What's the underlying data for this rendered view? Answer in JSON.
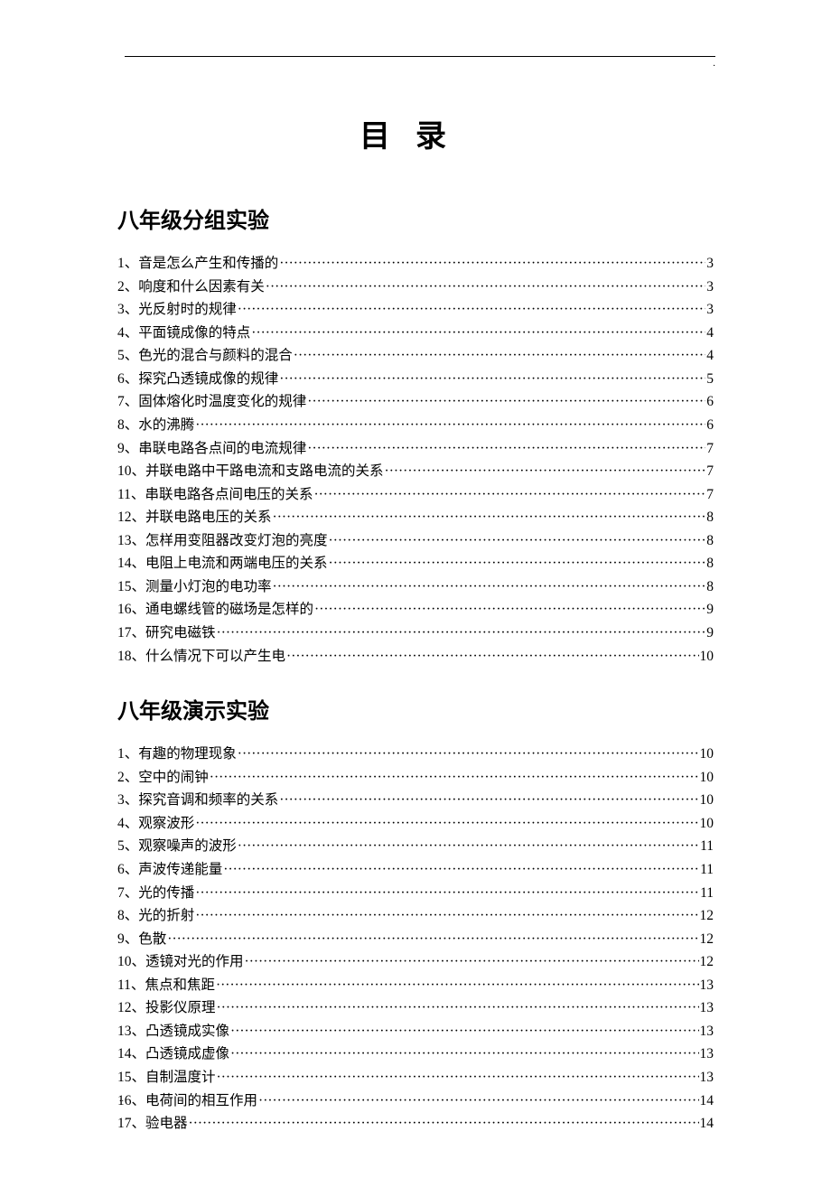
{
  "title": "目录",
  "sections": [
    {
      "header": "八年级分组实验",
      "items": [
        {
          "num": "1、",
          "label": "音是怎么产生和传播的",
          "page": "3"
        },
        {
          "num": "2、",
          "label": "响度和什么因素有关",
          "page": "3"
        },
        {
          "num": "3、",
          "label": "光反射时的规律",
          "page": "3"
        },
        {
          "num": "4、",
          "label": "平面镜成像的特点",
          "page": "4"
        },
        {
          "num": "5、",
          "label": "色光的混合与颜料的混合",
          "page": "4"
        },
        {
          "num": "6、",
          "label": "探究凸透镜成像的规律",
          "page": "5"
        },
        {
          "num": "7、",
          "label": "固体熔化时温度变化的规律",
          "page": "6"
        },
        {
          "num": "8、",
          "label": "水的沸腾",
          "page": "6"
        },
        {
          "num": "9、",
          "label": "串联电路各点间的电流规律",
          "page": "7"
        },
        {
          "num": "10、",
          "label": "并联电路中干路电流和支路电流的关系 ",
          "page": "7"
        },
        {
          "num": "11、",
          "label": "串联电路各点间电压的关系 ",
          "page": "7"
        },
        {
          "num": "12、",
          "label": "并联电路电压的关系 ",
          "page": "8"
        },
        {
          "num": "13、",
          "label": "怎样用变阻器改变灯泡的亮度 ",
          "page": "8"
        },
        {
          "num": "14、",
          "label": "电阻上电流和两端电压的关系 ",
          "page": "8"
        },
        {
          "num": "15、",
          "label": "测量小灯泡的电功率 ",
          "page": "8"
        },
        {
          "num": "16、",
          "label": "通电螺线管的磁场是怎样的 ",
          "page": "9"
        },
        {
          "num": "17、",
          "label": "研究电磁铁 ",
          "page": "9"
        },
        {
          "num": "18、",
          "label": "什么情况下可以产生电 ",
          "page": "10"
        }
      ]
    },
    {
      "header": "八年级演示实验",
      "items": [
        {
          "num": "1、",
          "label": "有趣的物理现象",
          "page": "10"
        },
        {
          "num": "2、",
          "label": "空中的闹钟",
          "page": "10"
        },
        {
          "num": "3、",
          "label": "探究音调和频率的关系",
          "page": "10"
        },
        {
          "num": "4、",
          "label": "观察波形",
          "page": "10"
        },
        {
          "num": "5、",
          "label": "观察噪声的波形",
          "page": "11"
        },
        {
          "num": "6、",
          "label": "声波传递能量",
          "page": "11"
        },
        {
          "num": "7、",
          "label": "光的传播",
          "page": "11"
        },
        {
          "num": "8、",
          "label": "光的折射",
          "page": "12"
        },
        {
          "num": "9、",
          "label": "色散",
          "page": "12"
        },
        {
          "num": "10、",
          "label": "透镜对光的作用 ",
          "page": "12"
        },
        {
          "num": "11、",
          "label": "焦点和焦距 ",
          "page": "13"
        },
        {
          "num": "12、",
          "label": "投影仪原理 ",
          "page": "13"
        },
        {
          "num": "13、",
          "label": "凸透镜成实像 ",
          "page": "13"
        },
        {
          "num": "14、",
          "label": "凸透镜成虚像 ",
          "page": "13"
        },
        {
          "num": "15、",
          "label": "自制温度计 ",
          "page": "13"
        },
        {
          "num": "16、",
          "label": "电荷间的相互作用 ",
          "page": "14"
        },
        {
          "num": "17、",
          "label": "验电器 ",
          "page": "14"
        }
      ]
    }
  ],
  "footer_mark": "..",
  "corner_mark": "."
}
